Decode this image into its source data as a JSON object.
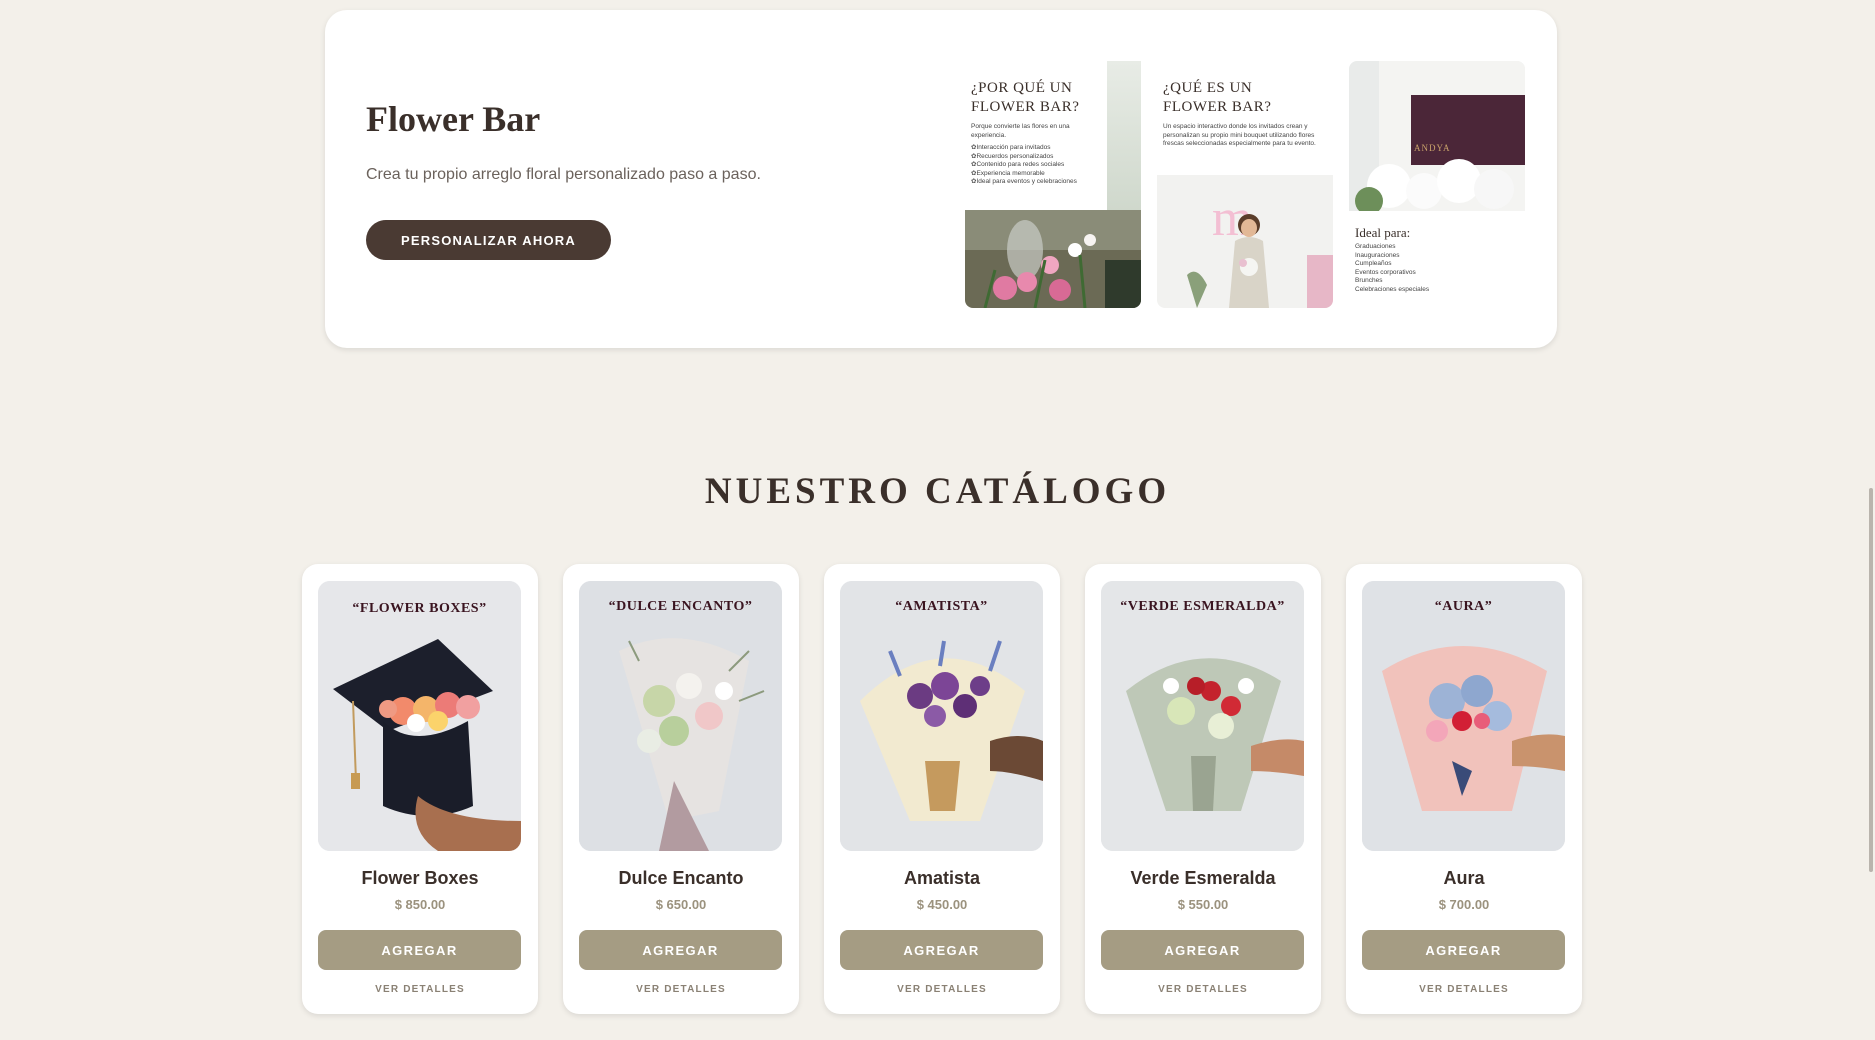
{
  "flower_bar": {
    "title": "Flower Bar",
    "description": "Crea tu propio arreglo floral personalizado paso a paso.",
    "cta_label": "PERSONALIZAR AHORA",
    "gallery": {
      "panel1": {
        "heading_line1": "¿POR QUÉ UN",
        "heading_line2": "FLOWER BAR?",
        "text": "Porque convierte las flores en una experiencia.",
        "items": [
          "Interacción para invitados",
          "Recuerdos personalizados",
          "Contenido para redes sociales",
          "Experiencia memorable",
          "Ideal para eventos y celebraciones"
        ]
      },
      "panel2": {
        "heading_line1": "¿QUÉ ES UN",
        "heading_line2": "FLOWER BAR?",
        "text": "Un espacio interactivo donde los invitados crean y personalizan su propio mini bouquet utilizando flores frescas seleccionadas especialmente para tu evento."
      },
      "panel3": {
        "brand": "ANDYA",
        "heading": "Ideal para:",
        "items": [
          "Graduaciones",
          "Inauguraciones",
          "Cumpleaños",
          "Eventos corporativos",
          "Brunches",
          "Celebraciones especiales"
        ]
      }
    }
  },
  "catalog": {
    "title": "NUESTRO CATÁLOGO",
    "add_label": "AGREGAR",
    "details_label": "VER DETALLES",
    "products": [
      {
        "image_label": "“FLOWER BOXES”",
        "name": "Flower Boxes",
        "price": "$ 850.00"
      },
      {
        "image_label": "“DULCE ENCANTO”",
        "name": "Dulce Encanto",
        "price": "$ 650.00"
      },
      {
        "image_label": "“AMATISTA”",
        "name": "Amatista",
        "price": "$ 450.00"
      },
      {
        "image_label": "“VERDE ESMERALDA”",
        "name": "Verde Esmeralda",
        "price": "$ 550.00"
      },
      {
        "image_label": "“AURA”",
        "name": "Aura",
        "price": "$ 700.00"
      }
    ]
  },
  "colors": {
    "page_bg": "#f3f0ea",
    "dark_brown": "#4a3a33",
    "add_button": "#a59c83",
    "price": "#9b927e"
  }
}
